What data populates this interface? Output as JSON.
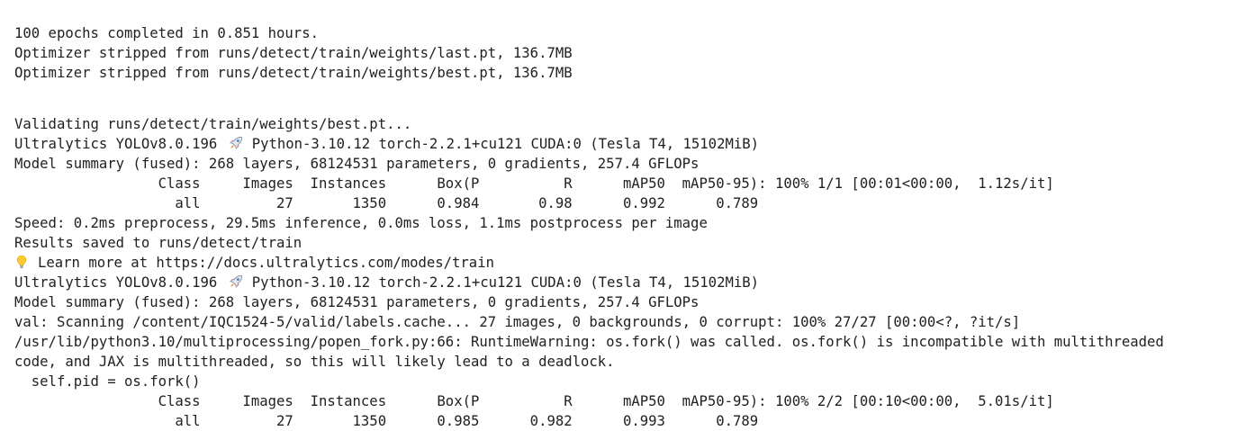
{
  "output": {
    "epochs_done": "100 epochs completed in 0.851 hours.",
    "strip_last": "Optimizer stripped from runs/detect/train/weights/last.pt, 136.7MB",
    "strip_best": "Optimizer stripped from runs/detect/train/weights/best.pt, 136.7MB",
    "validating": "Validating runs/detect/train/weights/best.pt...",
    "env_1_prefix": "Ultralytics YOLOv8.0.196 ",
    "env_1_suffix": "Python-3.10.12 torch-2.2.1+cu121 CUDA:0 (Tesla T4, 15102MiB)",
    "summary_1": "Model summary (fused): 268 layers, 68124531 parameters, 0 gradients, 257.4 GFLOPs",
    "metrics_header_1": "                 Class     Images  Instances      Box(P          R      mAP50  mAP50-95): 100% 1/1 [00:01<00:00,  1.12s/it]",
    "metrics_row_1": "                   all         27       1350      0.984       0.98      0.992      0.789",
    "speed": "Speed: 0.2ms preprocess, 29.5ms inference, 0.0ms loss, 1.1ms postprocess per image",
    "results_saved": "Results saved to runs/detect/train",
    "learn_more": "Learn more at https://docs.ultralytics.com/modes/train",
    "env_2_prefix": "Ultralytics YOLOv8.0.196 ",
    "env_2_suffix": "Python-3.10.12 torch-2.2.1+cu121 CUDA:0 (Tesla T4, 15102MiB)",
    "summary_2": "Model summary (fused): 268 layers, 68124531 parameters, 0 gradients, 257.4 GFLOPs",
    "val_scan": "val: Scanning /content/IQC1524-5/valid/labels.cache... 27 images, 0 backgrounds, 0 corrupt: 100% 27/27 [00:00<?, ?it/s]",
    "warning_1": "/usr/lib/python3.10/multiprocessing/popen_fork.py:66: RuntimeWarning: os.fork() was called. os.fork() is incompatible with multithreaded",
    "warning_2": "code, and JAX is multithreaded, so this will likely lead to a deadlock.",
    "warning_3": "  self.pid = os.fork()",
    "metrics_header_2": "                 Class     Images  Instances      Box(P          R      mAP50  mAP50-95): 100% 2/2 [00:10<00:00,  5.01s/it]",
    "metrics_row_2": "                   all         27       1350      0.985      0.982      0.993      0.789"
  },
  "icons": {
    "rocket": "rocket-icon",
    "lightbulb": "lightbulb-icon"
  }
}
